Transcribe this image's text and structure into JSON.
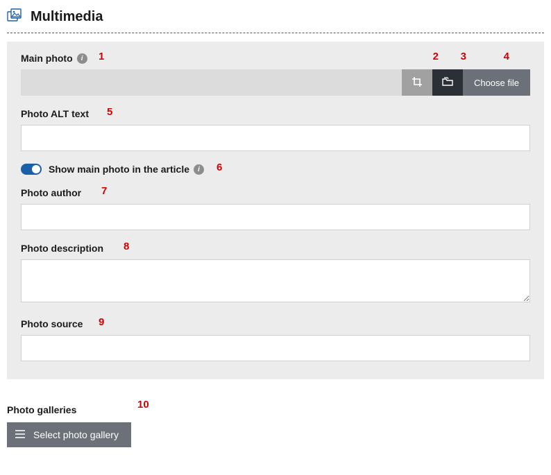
{
  "section": {
    "title": "Multimedia"
  },
  "main_photo": {
    "label": "Main photo",
    "choose_file_label": "Choose file",
    "value": ""
  },
  "alt_text": {
    "label": "Photo ALT text",
    "value": ""
  },
  "show_in_article": {
    "label": "Show main photo in the article",
    "value": true
  },
  "author": {
    "label": "Photo author",
    "value": ""
  },
  "description": {
    "label": "Photo description",
    "value": ""
  },
  "source": {
    "label": "Photo source",
    "value": ""
  },
  "galleries": {
    "title": "Photo galleries",
    "select_label": "Select photo gallery"
  },
  "annotations": [
    "1",
    "2",
    "3",
    "4",
    "5",
    "6",
    "7",
    "8",
    "9",
    "10"
  ]
}
